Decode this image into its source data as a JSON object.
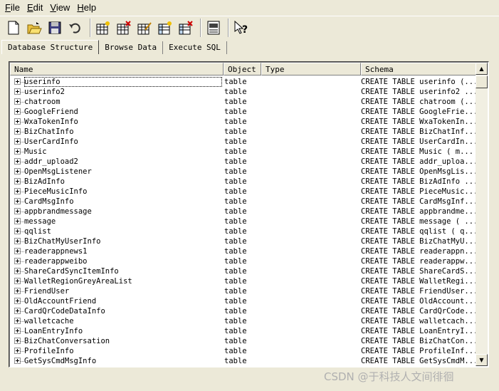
{
  "menu": {
    "file": "File",
    "edit": "Edit",
    "view": "View",
    "help": "Help"
  },
  "toolbar": {
    "icons": [
      "new-database-icon",
      "open-database-icon",
      "save-database-icon",
      "undo-icon",
      "create-table-icon",
      "delete-table-icon",
      "modify-table-icon",
      "create-index-icon",
      "delete-index-icon",
      "sql-log-icon",
      "whats-this-help-icon"
    ]
  },
  "tabs": [
    {
      "label": "Database Structure",
      "active": true
    },
    {
      "label": "Browse Data",
      "active": false
    },
    {
      "label": "Execute SQL",
      "active": false
    }
  ],
  "table": {
    "columns": [
      "Name",
      "Object",
      "Type",
      "Schema"
    ],
    "rows": [
      {
        "name": "userinfo",
        "object": "table",
        "type": "",
        "schema": "CREATE TABLE userinfo (..."
      },
      {
        "name": "userinfo2",
        "object": "table",
        "type": "",
        "schema": "CREATE TABLE userinfo2 ..."
      },
      {
        "name": "chatroom",
        "object": "table",
        "type": "",
        "schema": "CREATE TABLE chatroom (..."
      },
      {
        "name": "GoogleFriend",
        "object": "table",
        "type": "",
        "schema": "CREATE TABLE GoogleFrie..."
      },
      {
        "name": "WxaTokenInfo",
        "object": "table",
        "type": "",
        "schema": "CREATE TABLE WxaTokenIn..."
      },
      {
        "name": "BizChatInfo",
        "object": "table",
        "type": "",
        "schema": "CREATE TABLE BizChatInf..."
      },
      {
        "name": "UserCardInfo",
        "object": "table",
        "type": "",
        "schema": "CREATE TABLE UserCardIn..."
      },
      {
        "name": "Music",
        "object": "table",
        "type": "",
        "schema": "CREATE TABLE Music (  m..."
      },
      {
        "name": "addr_upload2",
        "object": "table",
        "type": "",
        "schema": "CREATE TABLE addr_uploa..."
      },
      {
        "name": "OpenMsgListener",
        "object": "table",
        "type": "",
        "schema": "CREATE TABLE OpenMsgLis..."
      },
      {
        "name": "BizAdInfo",
        "object": "table",
        "type": "",
        "schema": "CREATE TABLE BizAdInfo ..."
      },
      {
        "name": "PieceMusicInfo",
        "object": "table",
        "type": "",
        "schema": "CREATE TABLE PieceMusic..."
      },
      {
        "name": "CardMsgInfo",
        "object": "table",
        "type": "",
        "schema": "CREATE TABLE CardMsgInf..."
      },
      {
        "name": "appbrandmessage",
        "object": "table",
        "type": "",
        "schema": "CREATE TABLE appbrandme..."
      },
      {
        "name": "message",
        "object": "table",
        "type": "",
        "schema": "CREATE TABLE message ( ..."
      },
      {
        "name": "qqlist",
        "object": "table",
        "type": "",
        "schema": "CREATE TABLE qqlist ( q..."
      },
      {
        "name": "BizChatMyUserInfo",
        "object": "table",
        "type": "",
        "schema": "CREATE TABLE BizChatMyU..."
      },
      {
        "name": "readerappnews1",
        "object": "table",
        "type": "",
        "schema": "CREATE TABLE readerappn..."
      },
      {
        "name": "readerappweibo",
        "object": "table",
        "type": "",
        "schema": "CREATE TABLE readerappw..."
      },
      {
        "name": "ShareCardSyncItemInfo",
        "object": "table",
        "type": "",
        "schema": "CREATE TABLE ShareCardS..."
      },
      {
        "name": "WalletRegionGreyAreaList",
        "object": "table",
        "type": "",
        "schema": "CREATE TABLE WalletRegi..."
      },
      {
        "name": "FriendUser",
        "object": "table",
        "type": "",
        "schema": "CREATE TABLE FriendUser..."
      },
      {
        "name": "OldAccountFriend",
        "object": "table",
        "type": "",
        "schema": "CREATE TABLE OldAccount..."
      },
      {
        "name": "CardQrCodeDataInfo",
        "object": "table",
        "type": "",
        "schema": "CREATE TABLE CardQrCode..."
      },
      {
        "name": "walletcache",
        "object": "table",
        "type": "",
        "schema": "CREATE TABLE walletcach..."
      },
      {
        "name": "LoanEntryInfo",
        "object": "table",
        "type": "",
        "schema": "CREATE TABLE LoanEntryI..."
      },
      {
        "name": "BizChatConversation",
        "object": "table",
        "type": "",
        "schema": "CREATE TABLE BizChatCon..."
      },
      {
        "name": "ProfileInfo",
        "object": "table",
        "type": "",
        "schema": "CREATE TABLE ProfileInf..."
      },
      {
        "name": "GetSysCmdMsgInfo",
        "object": "table",
        "type": "",
        "schema": "CREATE TABLE GetSysCmdM..."
      }
    ]
  },
  "watermark": "CSDN @于科技人文间徘徊"
}
